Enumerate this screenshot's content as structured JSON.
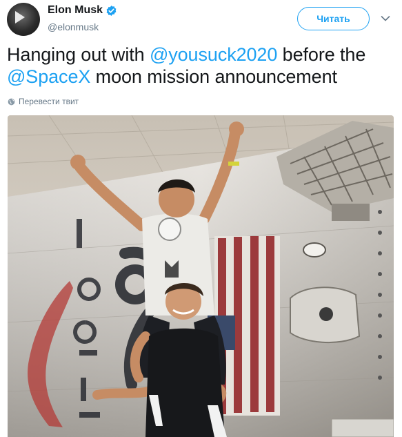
{
  "user": {
    "name": "Elon Musk",
    "handle": "@elonmusk",
    "verified_icon": "verified-badge-icon"
  },
  "actions": {
    "follow_label": "Читать",
    "menu_icon": "chevron-down-icon"
  },
  "tweet": {
    "text_1": "Hanging out with ",
    "mention_1": "@yousuck2020",
    "text_2": " before the ",
    "mention_2": "@SpaceX",
    "text_3": " moon mission announcement"
  },
  "translate": {
    "label": "Перевести твит",
    "icon": "globe-icon"
  },
  "colors": {
    "accent": "#1da1f2",
    "text": "#14171a",
    "muted": "#657786"
  }
}
